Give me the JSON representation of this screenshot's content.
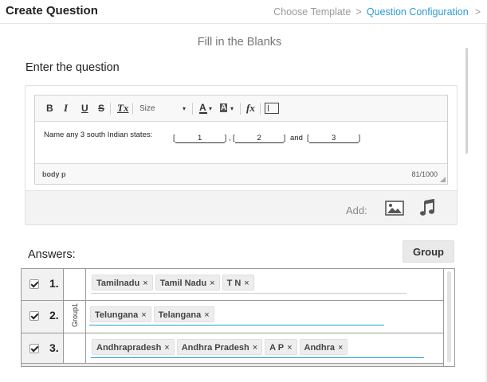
{
  "header": {
    "title": "Create Question",
    "breadcrumbs": [
      "Choose Template",
      "Question Configuration"
    ],
    "active_index": 1
  },
  "question_type": "Fill in the Blanks",
  "question_label": "Enter the question",
  "editor": {
    "toolbar": {
      "bold": "B",
      "italic": "I",
      "underline": "U",
      "strike": "S",
      "remove_format": "Tx",
      "size_label": "Size",
      "size_caret": "▾",
      "text_color": "A",
      "bg_color": "A",
      "formula": "fx"
    },
    "content": {
      "text": "Name any 3 south Indian states:",
      "blanks": [
        "1",
        "2",
        "3"
      ],
      "conjunction": "and",
      "separator": ","
    },
    "footer_path": "body  p",
    "char_count": "81/1000"
  },
  "add_bar": {
    "label": "Add:",
    "image_icon": "image-icon",
    "music_icon": "music-note-icon"
  },
  "answers": {
    "label": "Answers:",
    "group_button": "Group",
    "group_name": "Group1",
    "rows": [
      {
        "number": "1.",
        "checked": true,
        "tags": [
          "Tamilnadu",
          "Tamil Nadu",
          "T N"
        ],
        "underline_color": "#cccccc"
      },
      {
        "number": "2.",
        "checked": true,
        "tags": [
          "Telungana",
          "Telangana"
        ],
        "underline_color": "#2a9bd8"
      },
      {
        "number": "3.",
        "checked": true,
        "tags": [
          "Andhrapradesh",
          "Andhra Pradesh",
          "A P",
          "Andhra"
        ],
        "underline_color": "#2a9bd8"
      }
    ],
    "remove_glyph": "×"
  },
  "colors": {
    "accent": "#2a9bd8",
    "muted": "#9a9a9a"
  }
}
